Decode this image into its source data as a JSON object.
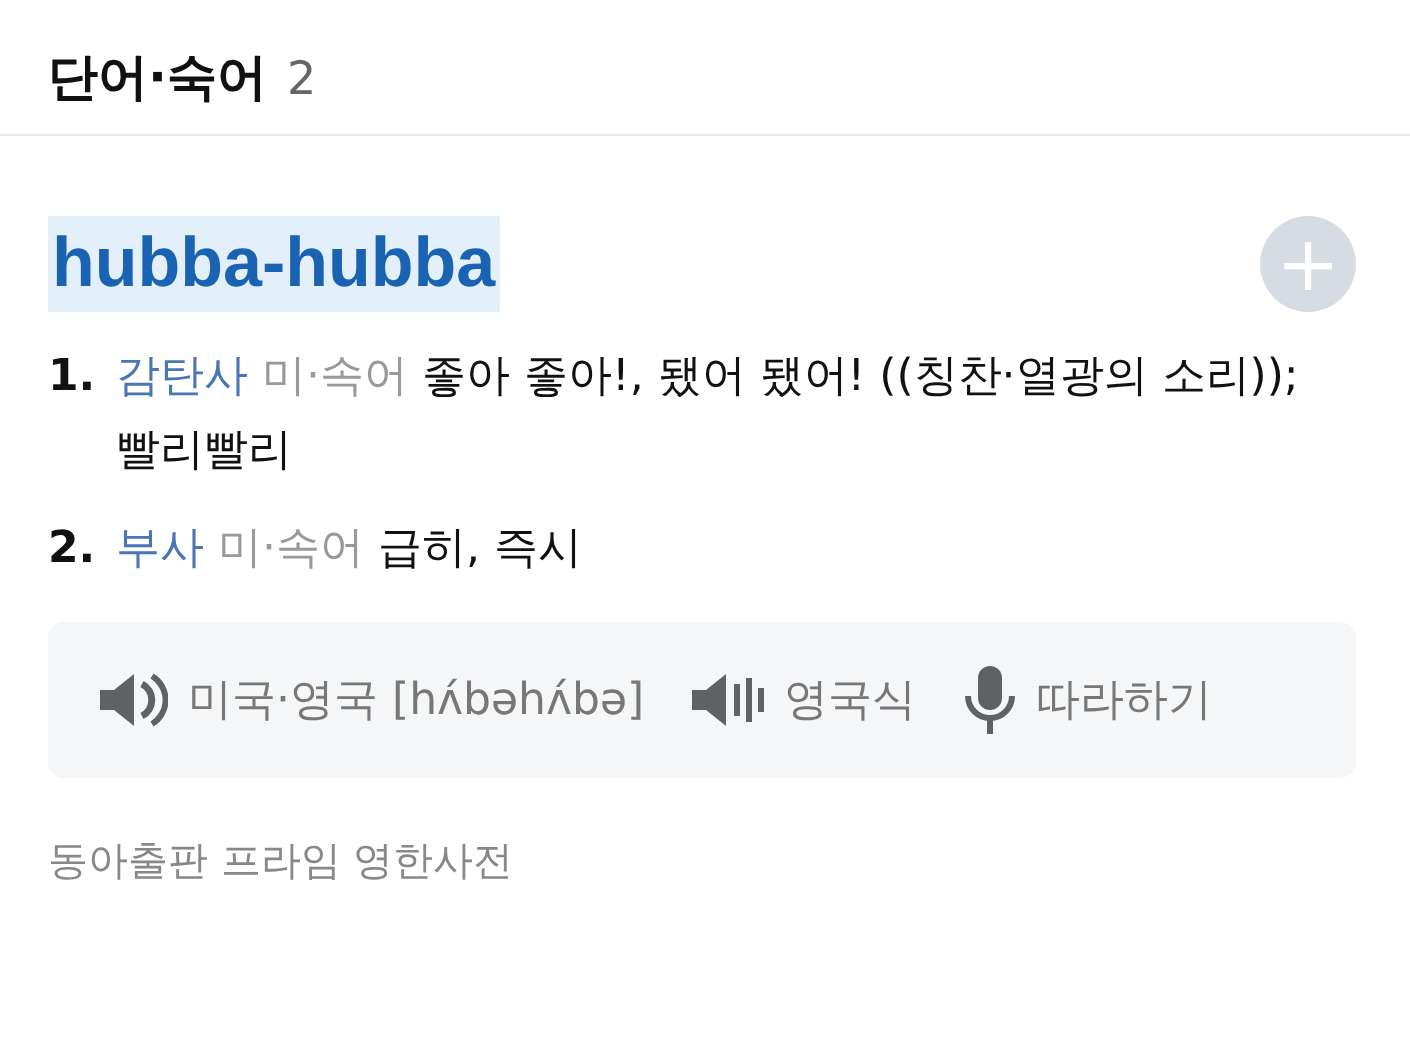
{
  "section": {
    "title": "단어·숙어",
    "count": "2"
  },
  "entry": {
    "word": "hubba-hubba",
    "add_button": "+"
  },
  "definitions": [
    {
      "number": "1.",
      "pos": "감탄사",
      "label": "미·속어",
      "meaning": "좋아 좋아!, 됐어 됐어! ((칭찬·열광의 소리)); 빨리빨리"
    },
    {
      "number": "2.",
      "pos": "부사",
      "label": "미·속어",
      "meaning": "급히, 즉시"
    }
  ],
  "pronunciation": [
    {
      "kind": "speaker",
      "label": "미국·영국 [hʌ́bəhʌ́bə]"
    },
    {
      "kind": "speaker-wave",
      "label": "영국식"
    },
    {
      "kind": "mic",
      "label": "따라하기"
    }
  ],
  "source": "동아출판 프라임 영한사전"
}
